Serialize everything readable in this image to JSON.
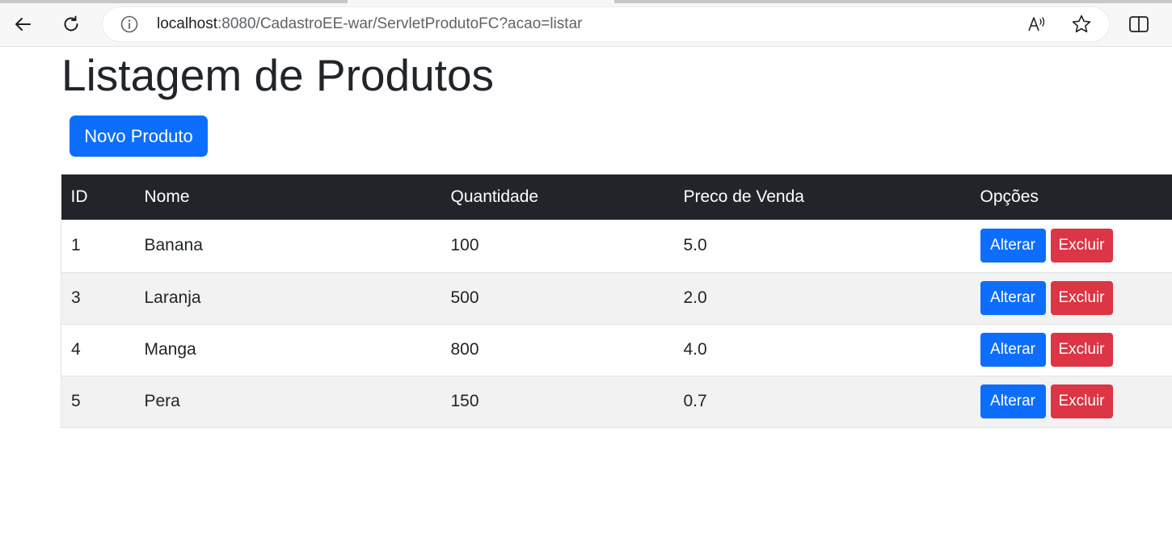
{
  "browser": {
    "url_host": "localhost",
    "url_rest": ":8080/CadastroEE-war/ServletProdutoFC?acao=listar"
  },
  "page": {
    "title": "Listagem de Produtos",
    "new_button": "Novo Produto"
  },
  "table": {
    "headers": [
      "ID",
      "Nome",
      "Quantidade",
      "Preco de Venda",
      "Opções"
    ],
    "rows": [
      {
        "id": "1",
        "nome": "Banana",
        "quantidade": "100",
        "preco": "5.0"
      },
      {
        "id": "3",
        "nome": "Laranja",
        "quantidade": "500",
        "preco": "2.0"
      },
      {
        "id": "4",
        "nome": "Manga",
        "quantidade": "800",
        "preco": "4.0"
      },
      {
        "id": "5",
        "nome": "Pera",
        "quantidade": "150",
        "preco": "0.7"
      }
    ],
    "alter_label": "Alterar",
    "delete_label": "Excluir"
  },
  "colors": {
    "primary": "#0d6efd",
    "danger": "#dc3545",
    "header_bg": "#212529"
  }
}
